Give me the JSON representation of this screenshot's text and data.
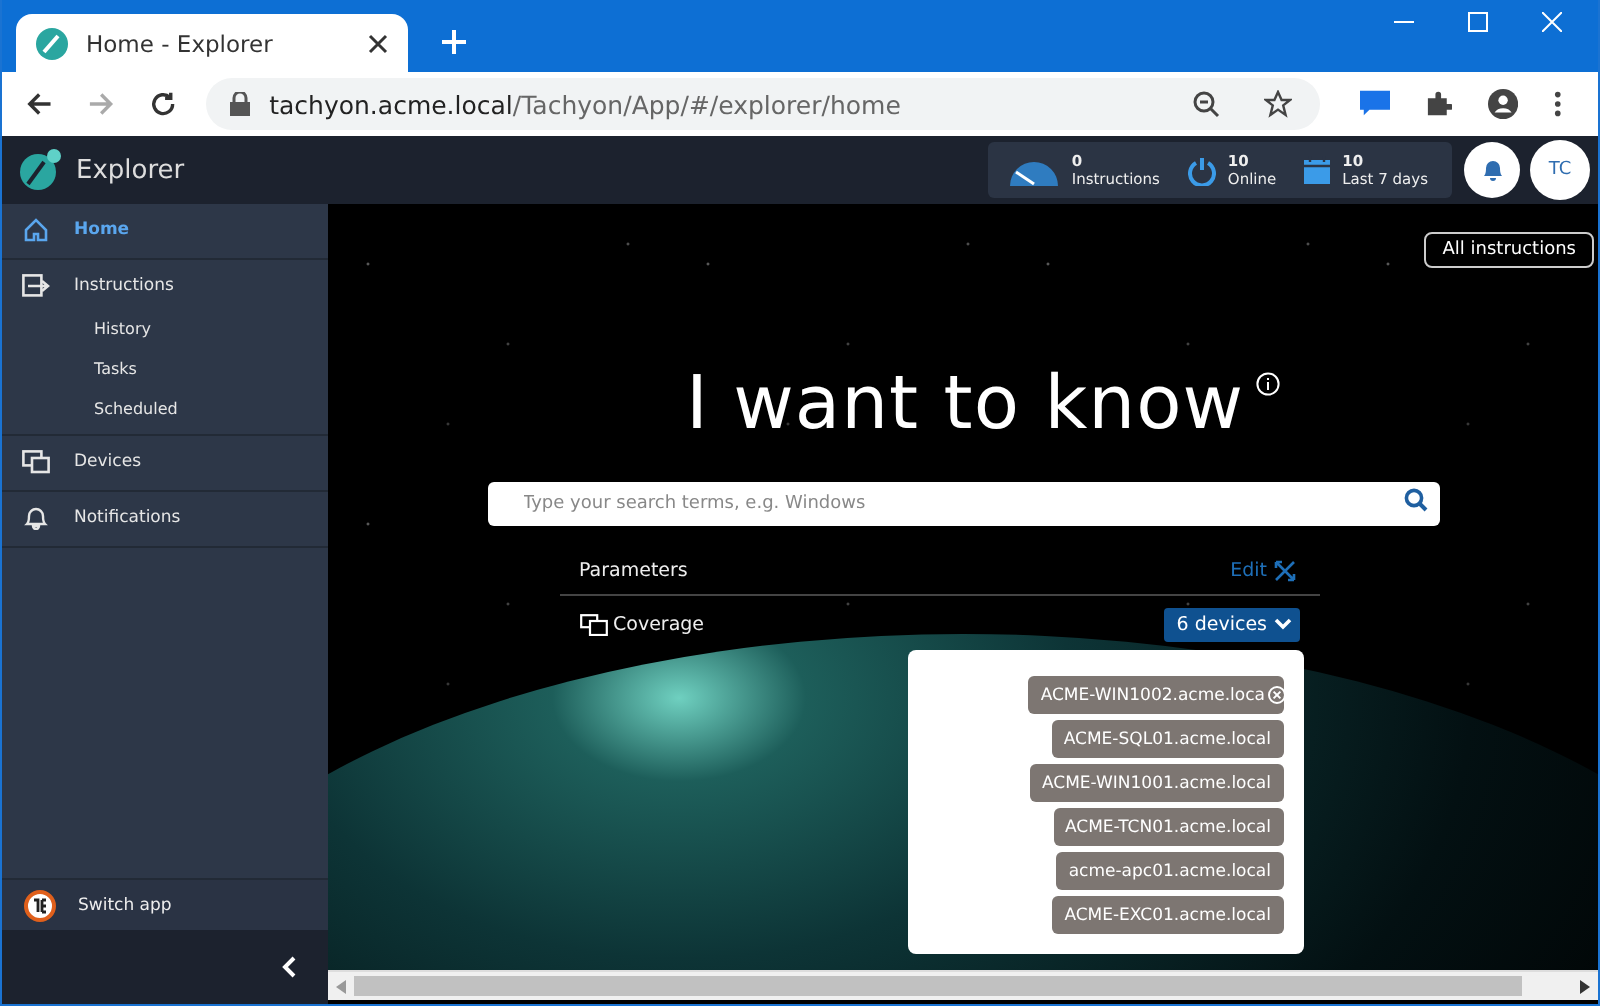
{
  "browser": {
    "tab_title": "Home - Explorer",
    "url_host": "tachyon.acme.local",
    "url_path": "/Tachyon/App/#/explorer/home"
  },
  "app": {
    "title": "Explorer"
  },
  "stats": [
    {
      "kind": "gauge",
      "value": "0",
      "label": "Instructions"
    },
    {
      "kind": "power",
      "value": "10",
      "label": "Online"
    },
    {
      "kind": "calendar",
      "value": "10",
      "label": "Last 7 days"
    }
  ],
  "user": {
    "initials": "TC"
  },
  "sidebar": {
    "items": [
      {
        "kind": "home",
        "label": "Home",
        "selected": true
      },
      {
        "kind": "instructions",
        "label": "Instructions",
        "selected": false,
        "children": [
          {
            "label": "History",
            "selected": false
          },
          {
            "label": "Tasks",
            "selected": false
          },
          {
            "label": "Scheduled",
            "selected": false
          }
        ]
      },
      {
        "kind": "devices",
        "label": "Devices",
        "selected": false
      },
      {
        "kind": "bell",
        "label": "Notifications",
        "selected": false
      }
    ],
    "switch_app": "Switch app"
  },
  "main": {
    "all_instructions": "All instructions",
    "heading": "I want to know",
    "search": {
      "placeholder": "Type your search terms, e.g. Windows"
    },
    "parameters": {
      "label": "Parameters",
      "edit": "Edit"
    },
    "coverage": {
      "label": "Coverage",
      "button": "6 devices",
      "expanded": true,
      "devices": [
        "ACME-WIN1002.acme.loca",
        "ACME-SQL01.acme.local",
        "ACME-WIN1001.acme.local",
        "ACME-TCN01.acme.local",
        "acme-apc01.acme.local",
        "ACME-EXC01.acme.local"
      ]
    }
  }
}
